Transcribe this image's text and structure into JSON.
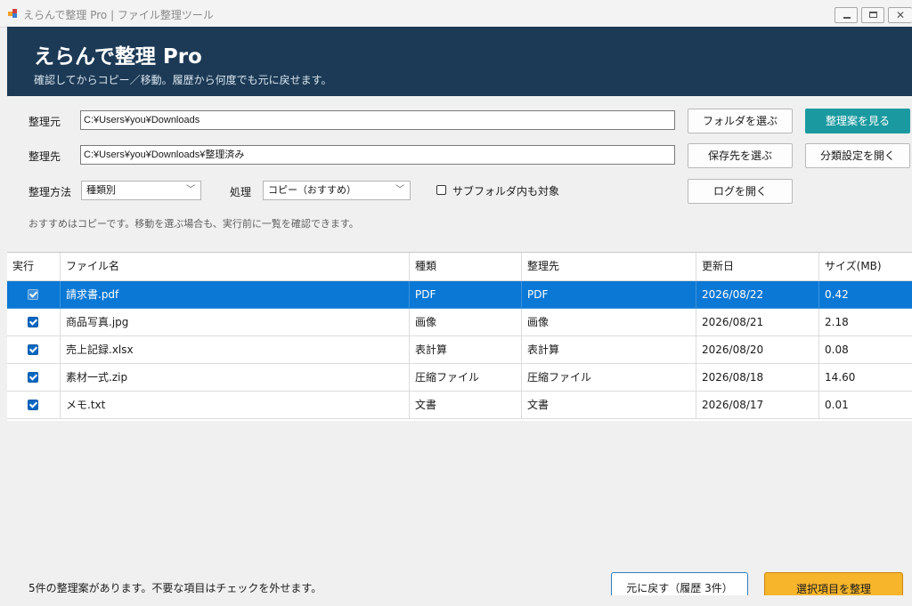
{
  "window": {
    "title": "えらんで整理 Pro | ファイル整理ツール",
    "controls": {
      "minimize_icon": "minimize-icon",
      "maximize_icon": "maximize-icon",
      "close_icon": "close-icon",
      "close_glyph": "✕"
    }
  },
  "header": {
    "title": "えらんで整理 Pro",
    "subtitle": "確認してからコピー／移動。履歴から何度でも元に戻せます。",
    "background_color": "#1c3a56"
  },
  "form": {
    "source": {
      "label": "整理元",
      "value": "C:¥Users¥you¥Downloads"
    },
    "destination": {
      "label": "整理先",
      "value": "C:¥Users¥you¥Downloads¥整理済み"
    },
    "method": {
      "label": "整理方法",
      "selected": "種類別"
    },
    "action": {
      "label": "処理",
      "selected": "コピー（おすすめ）"
    },
    "subfolder": {
      "label": "サブフォルダ内も対象",
      "checked": false
    },
    "hint": "おすすめはコピーです。移動を選ぶ場合も、実行前に一覧を確認できます。"
  },
  "buttons": {
    "choose_folder": "フォルダを選ぶ",
    "choose_destination": "保存先を選ぶ",
    "open_log": "ログを開く",
    "view_plan": "整理案を見る",
    "open_category_settings": "分類設定を開く",
    "undo": "元に戻す（履歴 3件）",
    "run_selected": "選択項目を整理",
    "accent_color": "#1a9aa0",
    "primary_color": "#f7b52c"
  },
  "table": {
    "columns": [
      "実行",
      "ファイル名",
      "種類",
      "整理先",
      "更新日",
      "サイズ(MB)"
    ],
    "rows": [
      {
        "checked": true,
        "name": "請求書.pdf",
        "type": "PDF",
        "dest": "PDF",
        "date": "2026/08/22",
        "size": "0.42",
        "selected": true
      },
      {
        "checked": true,
        "name": "商品写真.jpg",
        "type": "画像",
        "dest": "画像",
        "date": "2026/08/21",
        "size": "2.18"
      },
      {
        "checked": true,
        "name": "売上記録.xlsx",
        "type": "表計算",
        "dest": "表計算",
        "date": "2026/08/20",
        "size": "0.08"
      },
      {
        "checked": true,
        "name": "素材一式.zip",
        "type": "圧縮ファイル",
        "dest": "圧縮ファイル",
        "date": "2026/08/18",
        "size": "14.60"
      },
      {
        "checked": true,
        "name": "メモ.txt",
        "type": "文書",
        "dest": "文書",
        "date": "2026/08/17",
        "size": "0.01"
      }
    ],
    "selection_color": "#0a78d4"
  },
  "status": {
    "message": "5件の整理案があります。不要な項目はチェックを外せます。"
  }
}
